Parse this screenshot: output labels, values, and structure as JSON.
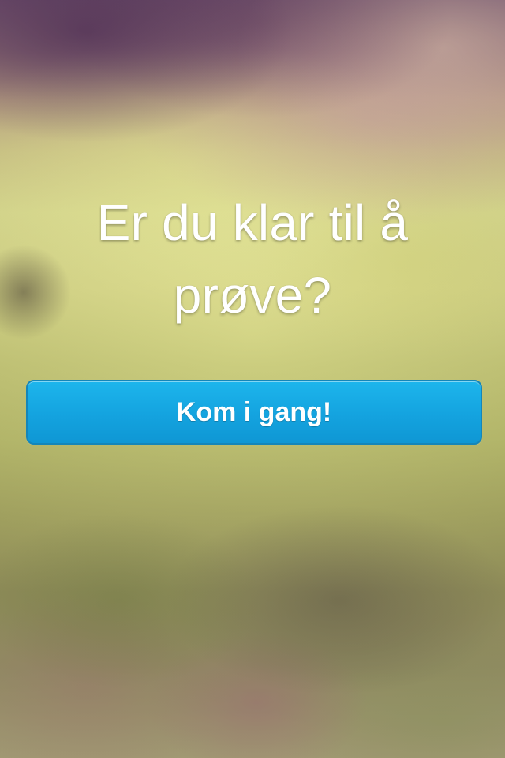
{
  "headline": {
    "line1": "Er du klar til å",
    "line2": "prøve?"
  },
  "cta": {
    "label": "Kom i gang!"
  },
  "colors": {
    "button_fill": "#14a3df",
    "button_border": "#1586b9",
    "text": "#ffffff"
  }
}
